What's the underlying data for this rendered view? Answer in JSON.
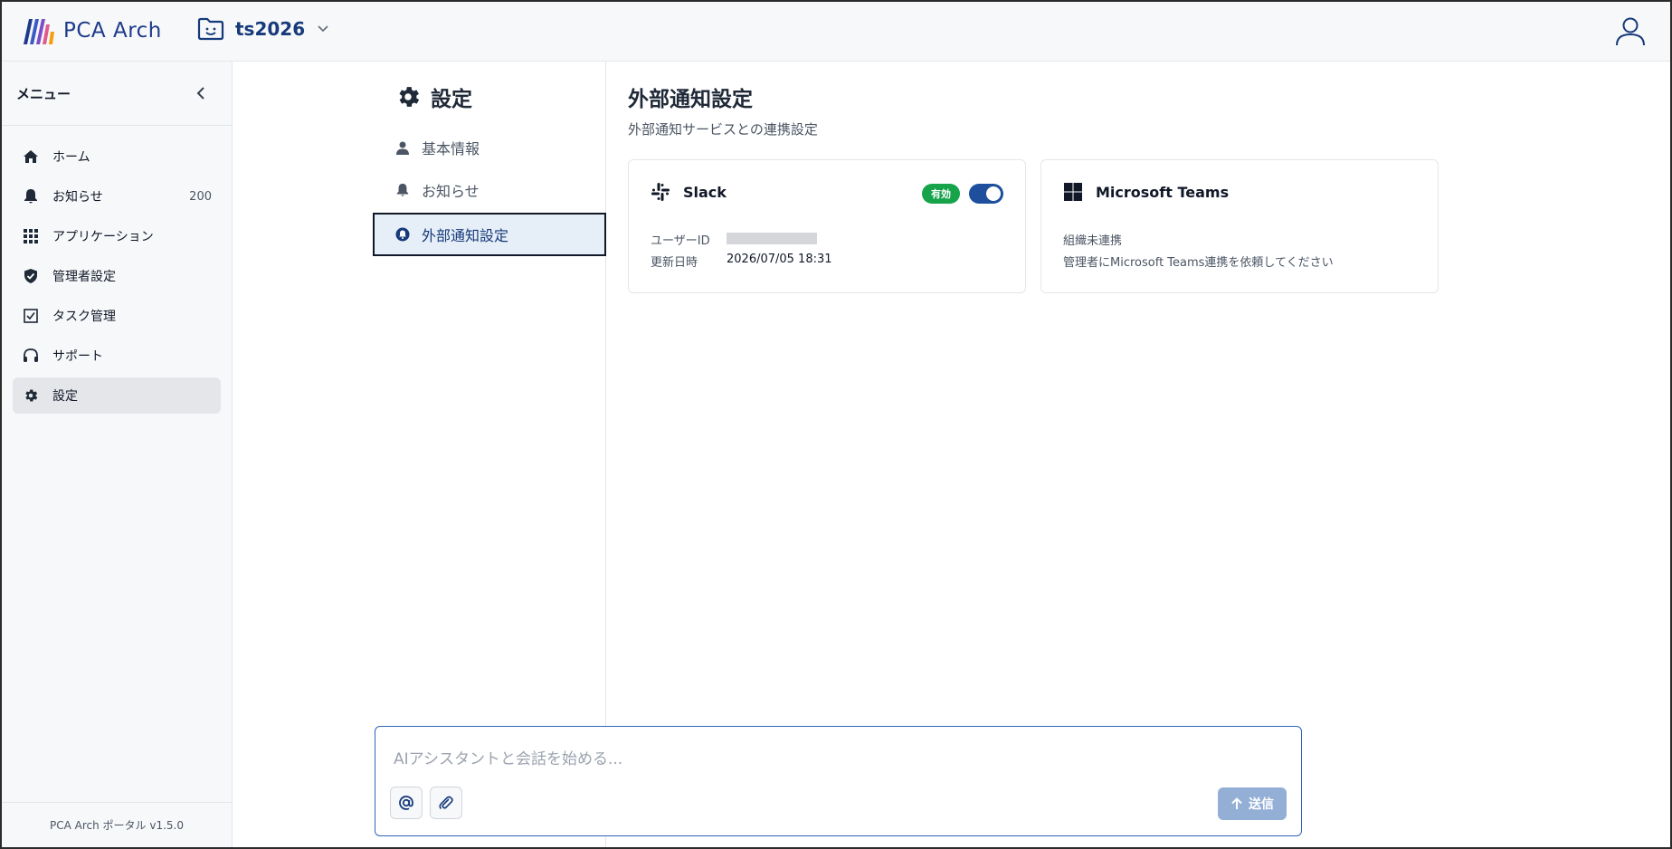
{
  "header": {
    "app_name": "PCA Arch",
    "project_name": "ts2026"
  },
  "sidebar": {
    "title": "メニュー",
    "items": [
      {
        "label": "ホーム",
        "icon": "home-icon"
      },
      {
        "label": "お知らせ",
        "icon": "bell-icon",
        "count": "200"
      },
      {
        "label": "アプリケーション",
        "icon": "grid-icon"
      },
      {
        "label": "管理者設定",
        "icon": "shield-icon"
      },
      {
        "label": "タスク管理",
        "icon": "checkbox-icon"
      },
      {
        "label": "サポート",
        "icon": "headset-icon"
      },
      {
        "label": "設定",
        "icon": "gear-icon",
        "active": true
      }
    ],
    "footer": "PCA Arch ポータル v1.5.0"
  },
  "settings_nav": {
    "title": "設定",
    "items": [
      {
        "label": "基本情報",
        "icon": "user-icon"
      },
      {
        "label": "お知らせ",
        "icon": "bell-icon"
      },
      {
        "label": "外部通知設定",
        "icon": "bell-circle-icon",
        "active": true
      }
    ]
  },
  "main": {
    "title": "外部通知設定",
    "subtitle": "外部通知サービスとの連携設定",
    "slack": {
      "name": "Slack",
      "status_badge": "有効",
      "enabled": true,
      "user_id_label": "ユーザーID",
      "updated_label": "更新日時",
      "updated_value": "2026/07/05 18:31"
    },
    "teams": {
      "name": "Microsoft Teams",
      "line1": "組織未連携",
      "line2": "管理者にMicrosoft Teams連携を依頼してください"
    }
  },
  "chat": {
    "placeholder": "AIアシスタントと会話を始める...",
    "send_label": "送信"
  },
  "colors": {
    "brand": "#163a7a",
    "toggle_on": "#1d4f9c",
    "badge_green": "#16a34a",
    "send_disabled": "#93afd6"
  }
}
